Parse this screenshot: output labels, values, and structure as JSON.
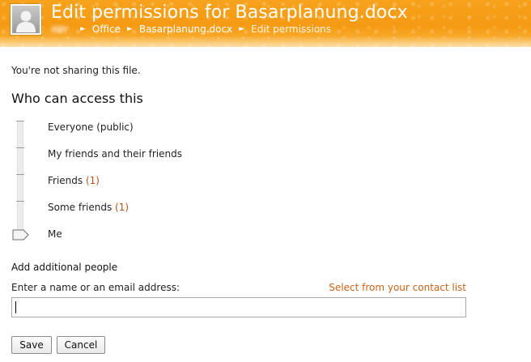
{
  "header": {
    "title": "Edit permissions for Basarplanung.docx",
    "breadcrumb": {
      "items": [
        "Office",
        "Basarplanung.docx"
      ],
      "current": "Edit permissions",
      "separator": "►"
    },
    "accent_color": "#f7a21c"
  },
  "status_text": "You're not sharing this file.",
  "access": {
    "title": "Who can access this",
    "levels": [
      {
        "label": "Everyone (public)",
        "count": ""
      },
      {
        "label": "My friends and their friends",
        "count": ""
      },
      {
        "label": "Friends",
        "count": "(1)"
      },
      {
        "label": "Some friends",
        "count": "(1)"
      },
      {
        "label": "Me",
        "count": ""
      }
    ],
    "selected": "Me"
  },
  "add_people": {
    "title": "Add additional people",
    "input_label": "Enter a name or an email address:",
    "contact_link": "Select from your contact list",
    "input_value": ""
  },
  "buttons": {
    "save": "Save",
    "cancel": "Cancel"
  },
  "colors": {
    "link": "#c8641a",
    "count": "#b4541a"
  }
}
